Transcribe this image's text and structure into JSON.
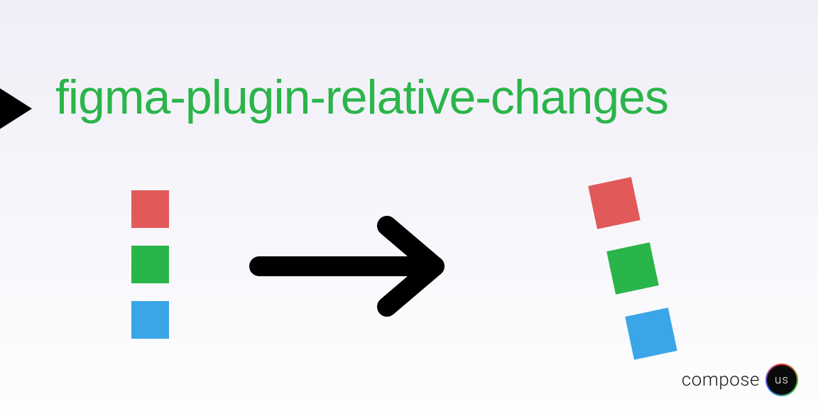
{
  "title": "figma-plugin-relative-changes",
  "colors": {
    "red": "#e15959",
    "green": "#2ab54a",
    "blue": "#3aa6e8"
  },
  "logo": {
    "word": "compose",
    "badge": "us"
  }
}
